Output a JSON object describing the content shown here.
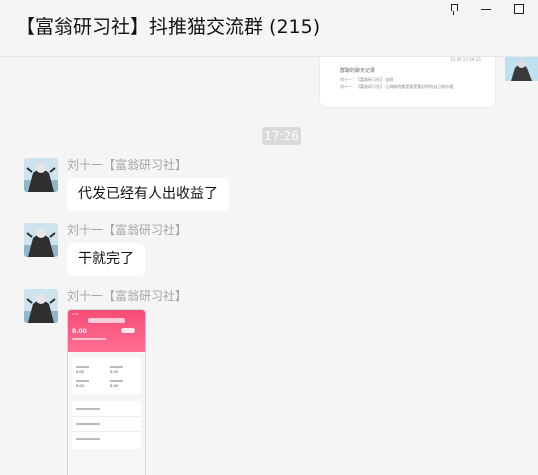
{
  "window": {
    "title": "【富翁研习社】抖推猫交流群 (215)"
  },
  "top_card": {
    "meta": "12:09 17:49:15",
    "heading": "群聊的聊天记录",
    "lines": [
      "刘十一：【富翁研习社】:自刷",
      "刘十一：【富翁研习社】:让刷刷的都是要是要好的的自己刷价格"
    ]
  },
  "timestamp": "17:26",
  "messages": [
    {
      "sender": "刘十一【富翁研习社】",
      "text": "代发已经有人出收益了"
    },
    {
      "sender": "刘十一【富翁研习社】",
      "text": "干就完了"
    },
    {
      "sender": "刘十一【富翁研习社】",
      "image": {
        "status_time": "9:41",
        "amount": "0.00",
        "card_values": [
          "0.00",
          "0.00",
          "0.00",
          "0.00"
        ]
      }
    }
  ],
  "colors": {
    "accent_pink": "#f54c75",
    "bubble": "#ffffff",
    "background": "#f5f5f5"
  }
}
